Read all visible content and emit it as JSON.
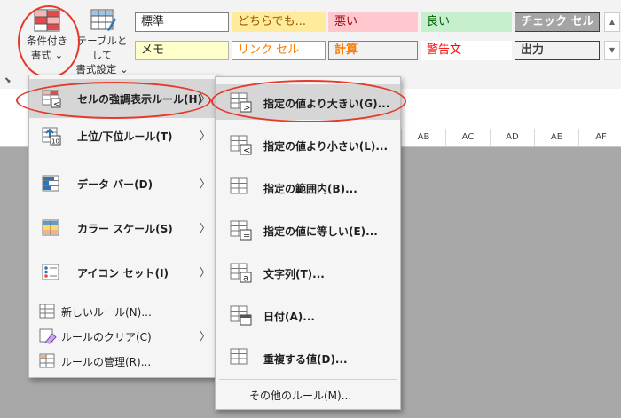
{
  "ribbon": {
    "cond_format": {
      "line1": "条件付き",
      "line2": "書式 ⌄"
    },
    "format_table": {
      "line1": "テーブルとして",
      "line2": "書式設定 ⌄"
    },
    "styles": [
      {
        "label": "標準",
        "bg": "#ffffff",
        "fg": "#222222",
        "border": "#7f7f7f"
      },
      {
        "label": "どちらでも...",
        "bg": "#ffeb9c",
        "fg": "#9c5700",
        "border": "#ffeb9c"
      },
      {
        "label": "悪い",
        "bg": "#ffc7ce",
        "fg": "#9c0006",
        "border": "#ffc7ce"
      },
      {
        "label": "良い",
        "bg": "#c6efce",
        "fg": "#006100",
        "border": "#c6efce"
      },
      {
        "label": "チェック セル",
        "bg": "#a5a5a5",
        "fg": "#ffffff",
        "border": "#3f3f3f"
      },
      {
        "label": "メモ",
        "bg": "#ffffcc",
        "fg": "#222222",
        "border": "#b2b2b2"
      },
      {
        "label": "リンク セル",
        "bg": "#ffffff",
        "fg": "#fa7d00",
        "border": "#fa7d00"
      },
      {
        "label": "計算",
        "bg": "#f2f2f2",
        "fg": "#fa7d00",
        "border": "#7f7f7f"
      },
      {
        "label": "警告文",
        "bg": "#ffffff",
        "fg": "#ff0000",
        "border": "#ffffff"
      },
      {
        "label": "出力",
        "bg": "#f2f2f2",
        "fg": "#3f3f3f",
        "border": "#3f3f3f"
      }
    ]
  },
  "columns": [
    "AB",
    "AC",
    "AD",
    "AE",
    "AF"
  ],
  "main_menu": {
    "items": [
      {
        "label": "セルの強調表示ルール(H)",
        "icon": "highlight-rules-icon"
      },
      {
        "label": "上位/下位ルール(T)",
        "icon": "top-bottom-icon"
      },
      {
        "label": "データ バー(D)",
        "icon": "data-bar-icon"
      },
      {
        "label": "カラー スケール(S)",
        "icon": "color-scale-icon"
      },
      {
        "label": "アイコン セット(I)",
        "icon": "icon-set-icon"
      }
    ],
    "small_items": [
      {
        "label": "新しいルール(N)...",
        "icon": "new-rule-icon"
      },
      {
        "label": "ルールのクリア(C)",
        "icon": "clear-rule-icon"
      },
      {
        "label": "ルールの管理(R)...",
        "icon": "manage-rule-icon"
      }
    ],
    "arrow": "〉"
  },
  "sub_menu": {
    "items": [
      {
        "label": "指定の値より大きい(G)...",
        "glyph": ">"
      },
      {
        "label": "指定の値より小さい(L)...",
        "glyph": "<"
      },
      {
        "label": "指定の範囲内(B)...",
        "glyph": ""
      },
      {
        "label": "指定の値に等しい(E)...",
        "glyph": "="
      },
      {
        "label": "文字列(T)...",
        "glyph": "a"
      },
      {
        "label": "日付(A)...",
        "glyph": ""
      },
      {
        "label": "重複する値(D)...",
        "glyph": ""
      }
    ],
    "more": "その他のルール(M)..."
  },
  "colors": {
    "accent_red": "#e53a2a",
    "blue": "#2e75b6",
    "menu_bg": "#f5f5f5"
  }
}
